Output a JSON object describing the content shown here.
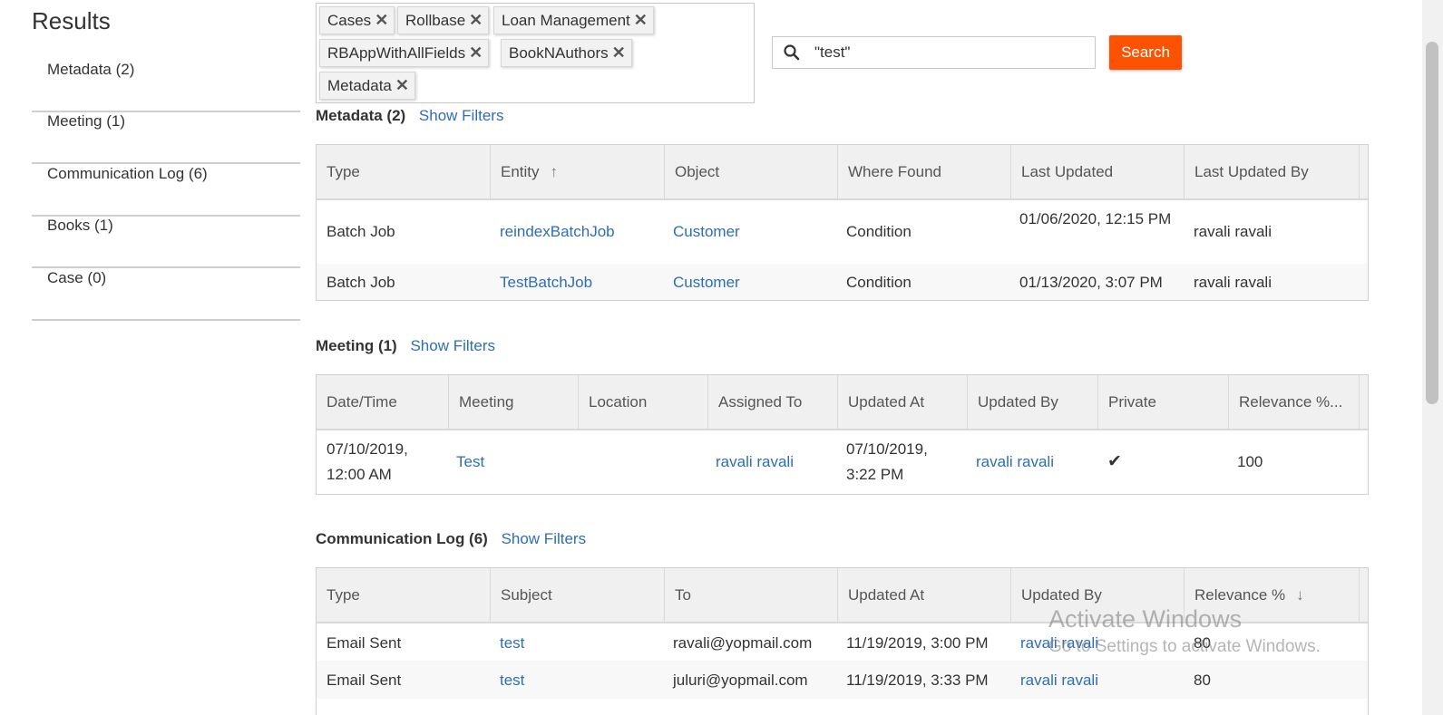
{
  "sidebar": {
    "title": "Results",
    "items": [
      {
        "label": "Metadata (2)"
      },
      {
        "label": "Meeting (1)"
      },
      {
        "label": "Communication Log (6)"
      },
      {
        "label": "Books (1)"
      },
      {
        "label": "Case (0)"
      }
    ]
  },
  "tags": [
    {
      "label": "Cases"
    },
    {
      "label": "Rollbase"
    },
    {
      "label": "Loan Management"
    },
    {
      "label": "RBAppWithAllFields"
    },
    {
      "label": "BookNAuthors"
    },
    {
      "label": "Metadata"
    }
  ],
  "tag_remove_glyph": "✕",
  "search": {
    "value": "\"test\"",
    "button_label": "Search"
  },
  "colors": {
    "accent": "#ff5200",
    "link": "#2e6eb5"
  },
  "sections": {
    "metadata": {
      "title": "Metadata (2)",
      "filter_link": "Show Filters",
      "columns": [
        "Type",
        "Entity",
        "Object",
        "Where Found",
        "Last Updated",
        "Last Updated By"
      ],
      "sort_indicator": "↑",
      "rows": [
        [
          "Batch Job",
          "reindexBatchJob",
          "Customer",
          "Condition",
          "01/06/2020, 12:15 PM",
          "ravali ravali"
        ],
        [
          "Batch Job",
          "TestBatchJob",
          "Customer",
          "Condition",
          "01/13/2020, 3:07 PM",
          "ravali ravali"
        ]
      ]
    },
    "meeting": {
      "title": "Meeting (1)",
      "filter_link": "Show Filters",
      "columns": [
        "Date/Time",
        "Meeting",
        "Location",
        "Assigned To",
        "Updated At",
        "Updated By",
        "Private",
        "Relevance %..."
      ],
      "rows": [
        [
          "07/10/2019, 12:00 AM",
          "Test",
          "",
          "ravali ravali",
          "07/10/2019, 3:22 PM",
          "ravali ravali",
          "✔",
          "100"
        ]
      ]
    },
    "communication": {
      "title": "Communication Log (6)",
      "filter_link": "Show Filters",
      "columns": [
        "Type",
        "Subject",
        "To",
        "Updated At",
        "Updated By",
        "Relevance %"
      ],
      "sort_indicator": "↓",
      "rows": [
        [
          "Email Sent",
          "test",
          "ravali@yopmail.com",
          "11/19/2019, 3:00 PM",
          "ravali ravali",
          "80"
        ],
        [
          "Email Sent",
          "test",
          "juluri@yopmail.com",
          "11/19/2019, 3:33 PM",
          "ravali ravali",
          "80"
        ]
      ]
    }
  },
  "watermark": {
    "line1": "Activate Windows",
    "line2": "Go to Settings to activate Windows."
  }
}
